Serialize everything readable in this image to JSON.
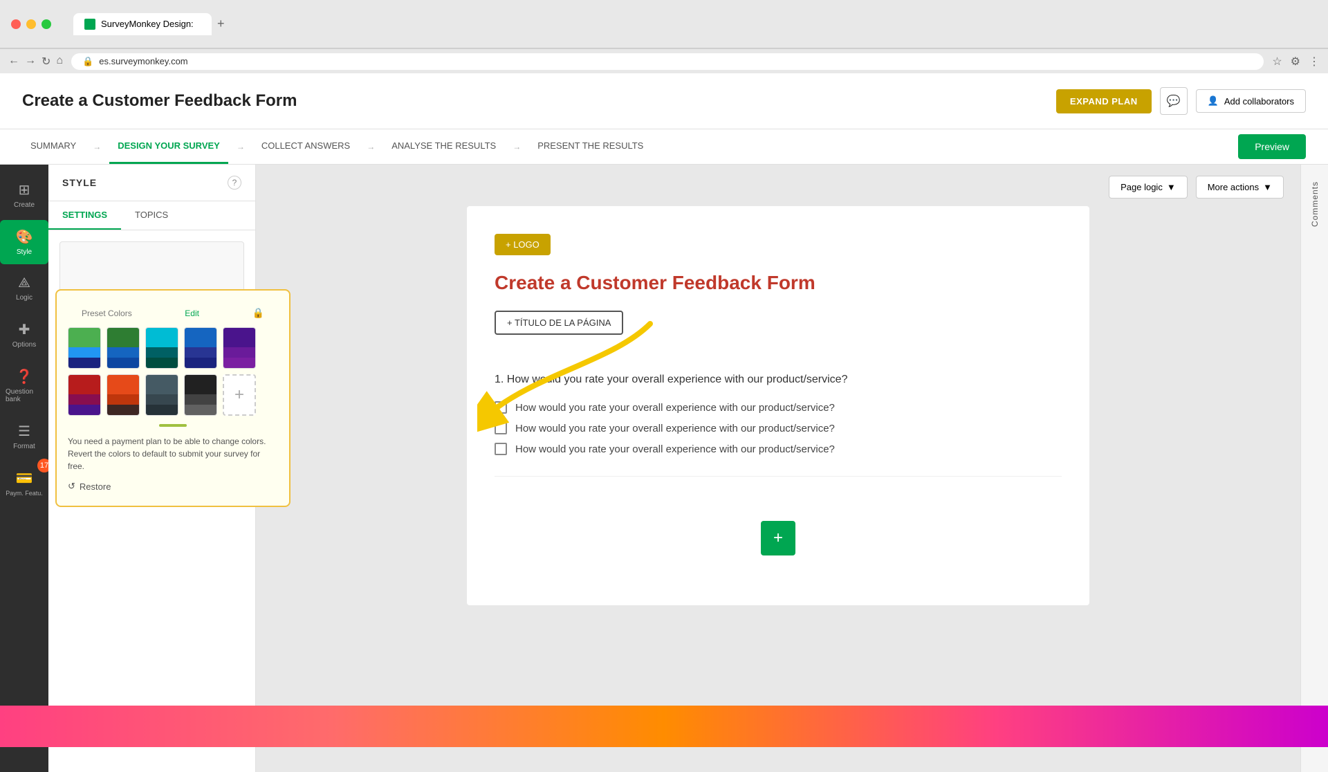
{
  "browser": {
    "url": "es.surveymonkey.com",
    "tab_title": "SurveyMonkey Design:",
    "tab_favicon": "SM"
  },
  "header": {
    "page_title": "Create a Customer Feedback Form",
    "expand_plan_label": "EXPAND PLAN",
    "add_collaborators_label": "Add collaborators"
  },
  "nav": {
    "tabs": [
      {
        "label": "SUMMARY",
        "active": false
      },
      {
        "label": "DESIGN YOUR SURVEY",
        "active": true
      },
      {
        "label": "COLLECT ANSWERS",
        "active": false
      },
      {
        "label": "ANALYSE THE RESULTS",
        "active": false
      },
      {
        "label": "PRESENT THE RESULTS",
        "active": false
      }
    ],
    "preview_label": "Preview"
  },
  "sidebar_icons": [
    {
      "icon": "⊞",
      "label": "Create",
      "active": false
    },
    {
      "icon": "🎨",
      "label": "Style",
      "active": true
    },
    {
      "icon": "⟁",
      "label": "Logic",
      "active": false
    },
    {
      "icon": "✚",
      "label": "Options",
      "active": false
    },
    {
      "icon": "❓",
      "label": "Question bank",
      "active": false
    },
    {
      "icon": "☰",
      "label": "Format",
      "active": false
    },
    {
      "icon": "💳",
      "label": "Payment Features",
      "active": false
    }
  ],
  "left_panel": {
    "title": "STYLE",
    "help_icon": "?",
    "tabs": [
      {
        "label": "SETTINGS",
        "active": true
      },
      {
        "label": "TOPICS",
        "active": false
      }
    ],
    "preset_label": "Preset Colors",
    "edit_label": "Edit",
    "restore_label": "Restore",
    "warning_text": "You need a payment plan to be able to change colors. Revert the colors to default to submit your survey for free."
  },
  "color_swatches_row1": [
    {
      "top": "#4caf50",
      "mid": "#2196f3",
      "bottom": "#1a237e"
    },
    {
      "top": "#2e7d32",
      "mid": "#1565c0",
      "bottom": "#0d47a1"
    },
    {
      "top": "#00bcd4",
      "mid": "#006064",
      "bottom": "#004d40"
    },
    {
      "top": "#1565c0",
      "mid": "#283593",
      "bottom": "#1a237e"
    },
    {
      "top": "#4a148c",
      "mid": "#6a1b9a",
      "bottom": "#7b1fa2"
    }
  ],
  "color_swatches_row2": [
    {
      "top": "#b71c1c",
      "mid": "#880e4f",
      "bottom": "#4a148c"
    },
    {
      "top": "#e64a19",
      "mid": "#bf360c",
      "bottom": "#3e2723"
    },
    {
      "top": "#455a64",
      "mid": "#37474f",
      "bottom": "#263238"
    },
    {
      "top": "#212121",
      "mid": "#424242",
      "bottom": "#616161"
    },
    "add"
  ],
  "survey": {
    "logo_label": "+ LOGO",
    "title": "Create a Customer Feedback Form",
    "page_title_btn": "+ TÍTULO DE LA PÁGINA",
    "question1": "1. How would you rate your overall experience with our product/service?",
    "options": [
      "How would you rate your overall experience with our product/service?",
      "How would you rate your overall experience with our product/service?",
      "How would you rate your overall experience with our product/service?"
    ]
  },
  "toolbar": {
    "page_logic_label": "Page logic",
    "more_actions_label": "More actions"
  },
  "right_panel": {
    "tab_label": "Comments"
  },
  "notification": {
    "badge": "17"
  }
}
